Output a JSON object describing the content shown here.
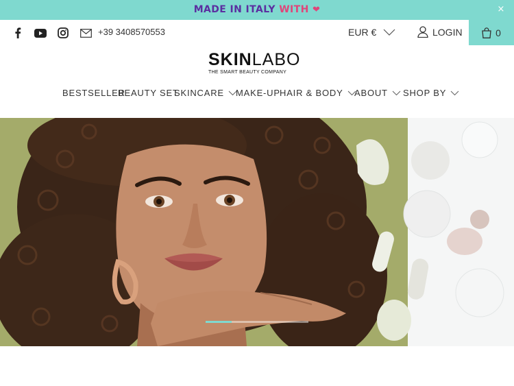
{
  "announcement": {
    "part1": "MADE IN ITALY",
    "part2": "WITH",
    "heart": "❤",
    "close": "×"
  },
  "header": {
    "social": [
      {
        "name": "facebook-icon"
      },
      {
        "name": "youtube-icon"
      },
      {
        "name": "instagram-icon"
      },
      {
        "name": "mail-icon"
      }
    ],
    "phone": "+39 3408570553",
    "currency": "EUR €",
    "login": "LOGIN",
    "cart_count": "0"
  },
  "logo": {
    "bold": "SKIN",
    "light": "LABO",
    "tagline": "THE SMART BEAUTY COMPANY"
  },
  "nav": [
    {
      "label": "BESTSELLER",
      "dropdown": false
    },
    {
      "label": "BEAUTY SET",
      "dropdown": false
    },
    {
      "label": "SKINCARE",
      "dropdown": true
    },
    {
      "label": "MAKE-UP",
      "dropdown": false
    },
    {
      "label": "HAIR & BODY",
      "dropdown": true
    },
    {
      "label": "ABOUT",
      "dropdown": true
    },
    {
      "label": "SHOP BY",
      "dropdown": true
    }
  ],
  "hero": {
    "slide_count": 4,
    "active_slide": 1
  },
  "colors": {
    "accent": "#7fd9cf",
    "purple": "#5b2fa0",
    "pink": "#e0457a",
    "hero_bg": "#a4ab6a"
  }
}
